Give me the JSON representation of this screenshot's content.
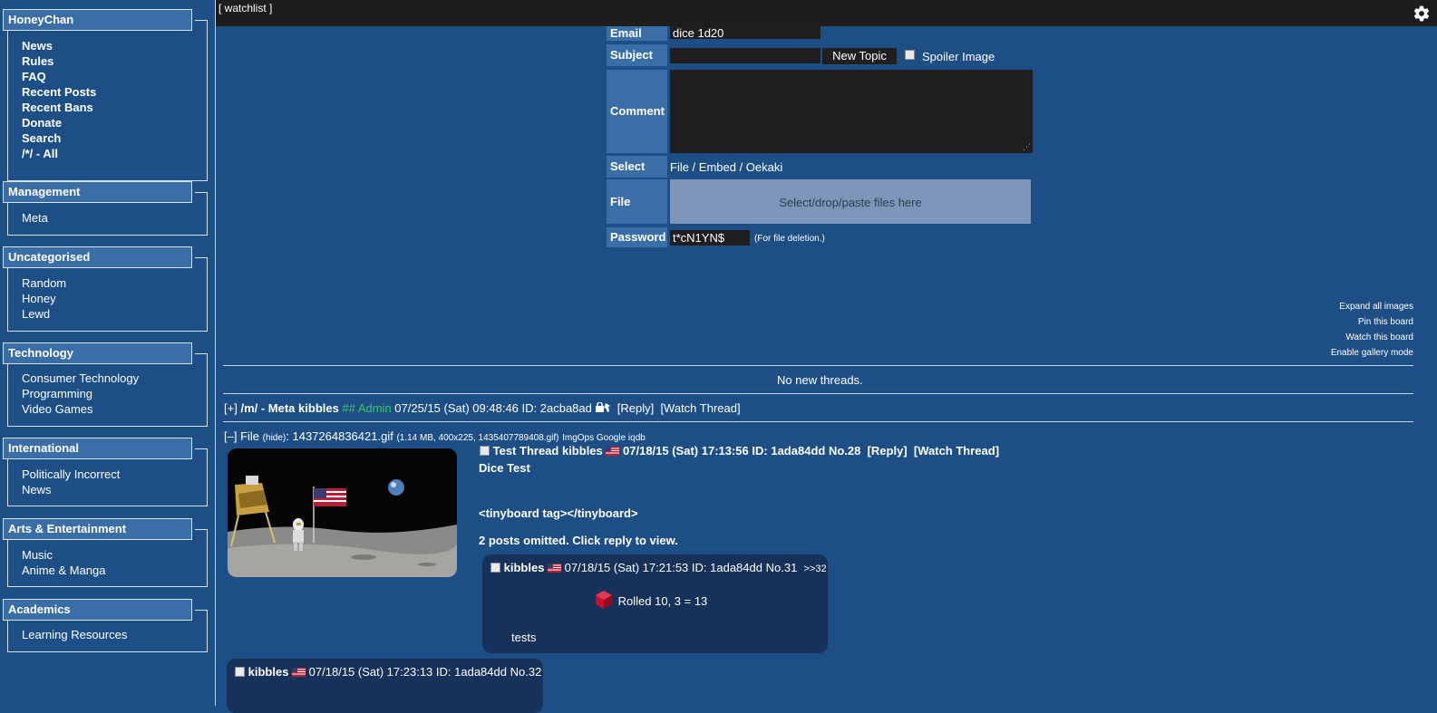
{
  "sidebar": {
    "sections": [
      {
        "title": "HoneyChan",
        "items": [
          "News",
          "Rules",
          "FAQ",
          "Recent Posts",
          "Recent Bans",
          "Donate",
          "Search",
          "/*/ - All"
        ]
      },
      {
        "title": "Management",
        "items": [
          "Meta"
        ]
      },
      {
        "title": "Uncategorised",
        "items": [
          "Random",
          "Honey",
          "Lewd"
        ]
      },
      {
        "title": "Technology",
        "items": [
          "Consumer Technology",
          "Programming",
          "Video Games"
        ]
      },
      {
        "title": "International",
        "items": [
          "Politically Incorrect",
          "News"
        ]
      },
      {
        "title": "Arts & Entertainment",
        "items": [
          "Music",
          "Anime & Manga"
        ]
      },
      {
        "title": "Academics",
        "items": [
          "Learning Resources"
        ]
      }
    ]
  },
  "topbar": {
    "watchlist": "[ watchlist ]",
    "settings_icon": "gear-icon"
  },
  "form": {
    "email_label": "Email",
    "email_value": "dice 1d20",
    "subject_label": "Subject",
    "subject_value": "",
    "new_topic_label": "New Topic",
    "spoiler_label": "Spoiler Image",
    "comment_label": "Comment",
    "select_label": "Select",
    "select_options": "File / Embed / Oekaki",
    "file_label": "File",
    "file_drop_text": "Select/drop/paste files here",
    "password_label": "Password",
    "password_value": "t*cN1YN$",
    "password_note": "(For file deletion.)"
  },
  "board_options": [
    "Expand all images",
    "Pin this board",
    "Watch this board",
    "Enable gallery mode"
  ],
  "no_new_threads": "No new threads.",
  "pinned_thread": {
    "toggle": "[+]",
    "board": "/m/ - Meta",
    "name": "kibbles",
    "capcode": "## Admin",
    "date": "07/25/15 (Sat) 09:48:46",
    "id": "ID: 2acba8ad",
    "reply": "[Reply]",
    "watch": "[Watch Thread]"
  },
  "thread": {
    "toggle": "[–]",
    "file_label": "File",
    "hide": "(hide)",
    "filename": "1437264836421.gif",
    "file_info": "(1.14 MB, 400x225, 1435407789408.gif)",
    "search_links": "ImgOps Google iqdb",
    "subject": "Test Thread",
    "name": "kibbles",
    "date": "07/18/15 (Sat) 17:13:56",
    "id": "ID: 1ada84dd",
    "number": "No.28",
    "reply": "[Reply]",
    "watch": "[Watch Thread]",
    "body_line1": "Dice Test",
    "body_line2": "<tinyboard tag></tinyboard>",
    "omitted": "2 posts omitted. Click reply to view."
  },
  "replies": [
    {
      "name": "kibbles",
      "date": "07/18/15 (Sat) 17:21:53",
      "id": "ID: 1ada84dd",
      "number": "No.31",
      "backlink": ">>32",
      "dice": "Rolled 10, 3 = 13",
      "body": "tests"
    },
    {
      "name": "kibbles",
      "date": "07/18/15 (Sat) 17:23:13",
      "id": "ID: 1ada84dd",
      "number": "No.32"
    }
  ]
}
